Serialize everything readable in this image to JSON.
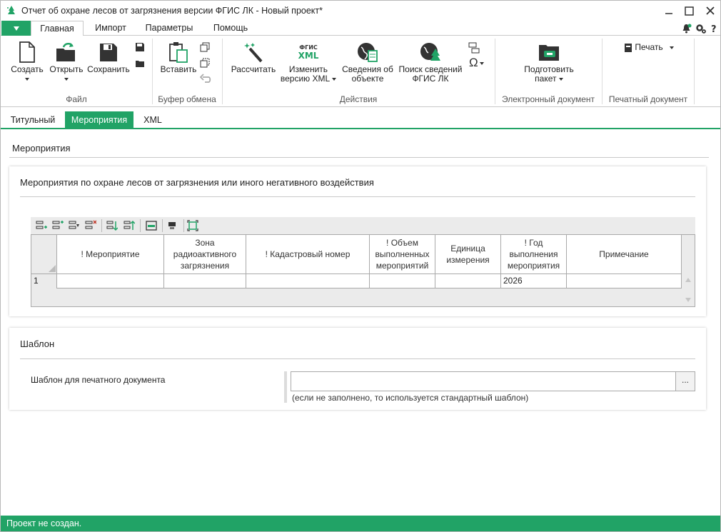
{
  "window": {
    "title": "Отчет об охране лесов от загрязнения версии ФГИС ЛК - Новый проект*"
  },
  "menu_tabs": [
    "Главная",
    "Импорт",
    "Параметры",
    "Помощь"
  ],
  "ribbon": {
    "file": {
      "label": "Файл",
      "create": "Создать",
      "open": "Открыть",
      "save": "Сохранить"
    },
    "clipboard": {
      "label": "Буфер обмена",
      "paste": "Вставить"
    },
    "actions": {
      "label": "Действия",
      "calculate": "Рассчитать",
      "change_xml_1": "Изменить",
      "change_xml_2": "версию XML",
      "xml_icon_top": "ФГИС",
      "xml_icon_bottom": "XML",
      "object_info_1": "Сведения об",
      "object_info_2": "объекте",
      "search_1": "Поиск сведений",
      "search_2": "ФГИС ЛК"
    },
    "edoc": {
      "label": "Электронный документ",
      "prepare_1": "Подготовить",
      "prepare_2": "пакет"
    },
    "print": {
      "label": "Печатный документ",
      "print": "Печать"
    }
  },
  "page_tabs": [
    "Титульный",
    "Мероприятия",
    "XML"
  ],
  "section_title": "Мероприятия",
  "measures_card": {
    "title": "Мероприятия по охране лесов от загрязнения или иного негативного воздействия",
    "columns": [
      "! Мероприятие",
      "Зона радиоактивного загрязнения",
      "! Кадастровый номер",
      "! Объем выполненных мероприятий",
      "Единица измерения",
      "! Год выполнения мероприятия",
      "Примечание"
    ],
    "rows": [
      {
        "num": "1",
        "cells": [
          "",
          "",
          "",
          "",
          "",
          "2026",
          ""
        ]
      }
    ]
  },
  "template_card": {
    "title": "Шаблон",
    "label": "Шаблон для печатного документа",
    "value": "",
    "browse": "...",
    "hint": "(если не заполнено, то используется стандартный шаблон)"
  },
  "status": "Проект не создан.",
  "colors": {
    "accent": "#21a366"
  }
}
